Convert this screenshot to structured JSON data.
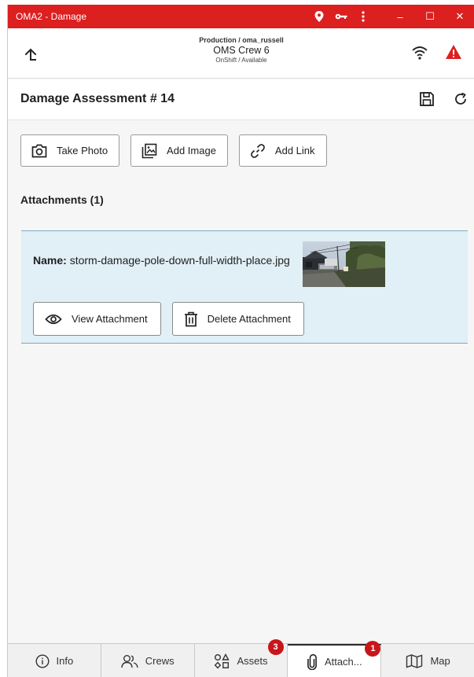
{
  "window": {
    "title": "OMA2 - Damage",
    "accent_color": "#dc1f1f",
    "icons": [
      "location-icon",
      "key-icon",
      "kebab-menu-icon"
    ],
    "controls": [
      "–",
      "☐",
      "✕"
    ]
  },
  "header": {
    "environment": "Production / oma_russell",
    "crew": "OMS Crew 6",
    "status": "OnShift / Available"
  },
  "page": {
    "title": "Damage Assessment # 14"
  },
  "actions": [
    {
      "label": "Take Photo",
      "icon": "camera-icon"
    },
    {
      "label": "Add Image",
      "icon": "image-icon"
    },
    {
      "label": "Add Link",
      "icon": "link-icon"
    }
  ],
  "attachments": {
    "heading": "Attachments (1)",
    "items": [
      {
        "name_label": "Name:",
        "name": "storm-damage-pole-down-full-width-place.jpg",
        "view_label": "View Attachment",
        "delete_label": "Delete Attachment"
      }
    ]
  },
  "nav": [
    {
      "label": "Info",
      "icon": "info-icon",
      "badge": null,
      "active": false
    },
    {
      "label": "Crews",
      "icon": "people-icon",
      "badge": null,
      "active": false
    },
    {
      "label": "Assets",
      "icon": "shapes-icon",
      "badge": "3",
      "active": false
    },
    {
      "label": "Attach...",
      "icon": "paperclip-icon",
      "badge": "1",
      "active": true
    },
    {
      "label": "Map",
      "icon": "map-icon",
      "badge": null,
      "active": false
    }
  ]
}
